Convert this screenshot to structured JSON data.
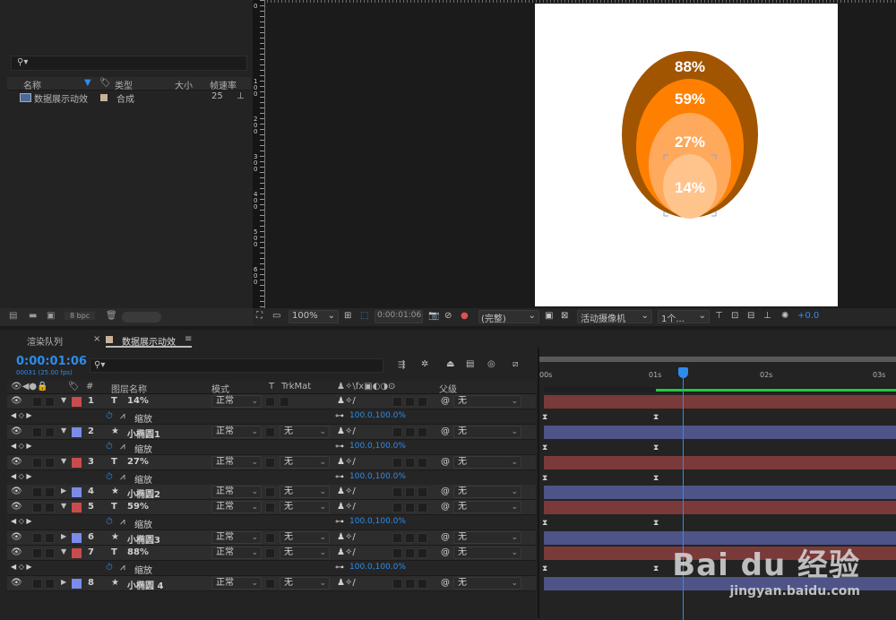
{
  "project": {
    "search_placeholder": "",
    "columns": [
      "名称",
      "类型",
      "大小",
      "帧速率"
    ],
    "items": [
      {
        "name": "数据展示动效",
        "type": "合成",
        "size": "",
        "fps": "25"
      }
    ],
    "bpc": "8 bpc"
  },
  "viewer": {
    "ruler_labels": [
      "0",
      "1 0 0",
      "2 0 0",
      "3 0 0",
      "4 0 0",
      "5 0 0",
      "6 0 0"
    ],
    "zoom": "100%",
    "timecode": "0:00:01:06",
    "resolution": "(完整)",
    "camera": "活动摄像机",
    "view": "1个...",
    "exposure": "+0.0",
    "circles": [
      {
        "label": "88%",
        "color": "#a15500"
      },
      {
        "label": "59%",
        "color": "#ff8000"
      },
      {
        "label": "27%",
        "color": "#ffa95c"
      },
      {
        "label": "14%",
        "color": "#ffc38c"
      }
    ]
  },
  "timeline": {
    "tabs": [
      "渲染队列",
      "数据展示动效"
    ],
    "timecode": "0:00:01:06",
    "fps_info": "00031 (25.00 fps)",
    "columns": {
      "hash": "#",
      "name": "图层名称",
      "mode": "模式",
      "t": "T",
      "trkmat": "TrkMat",
      "parent": "父级"
    },
    "ruler": [
      "00s",
      "01s",
      "02s",
      "03s"
    ],
    "rows": [
      {
        "kind": "layer",
        "num": "1",
        "name": "14%",
        "icon": "T",
        "label_color": "#c94c4c",
        "expanded": true,
        "mode": "正常",
        "trkmat": "",
        "parent": "无"
      },
      {
        "kind": "prop",
        "name": "缩放",
        "value": "100.0,100.0%"
      },
      {
        "kind": "layer",
        "num": "2",
        "name": "小椭圆1",
        "icon": "★",
        "label_color": "#7a8ce8",
        "expanded": true,
        "mode": "正常",
        "trkmat": "无",
        "parent": "无"
      },
      {
        "kind": "prop",
        "name": "缩放",
        "value": "100.0,100.0%"
      },
      {
        "kind": "layer",
        "num": "3",
        "name": "27%",
        "icon": "T",
        "label_color": "#c94c4c",
        "expanded": true,
        "mode": "正常",
        "trkmat": "无",
        "parent": "无"
      },
      {
        "kind": "prop",
        "name": "缩放",
        "value": "100.0,100.0%"
      },
      {
        "kind": "layer",
        "num": "4",
        "name": "小椭圆2",
        "icon": "★",
        "label_color": "#7a8ce8",
        "expanded": false,
        "mode": "正常",
        "trkmat": "无",
        "parent": "无"
      },
      {
        "kind": "layer",
        "num": "5",
        "name": "59%",
        "icon": "T",
        "label_color": "#c94c4c",
        "expanded": true,
        "mode": "正常",
        "trkmat": "无",
        "parent": "无"
      },
      {
        "kind": "prop",
        "name": "缩放",
        "value": "100.0,100.0%"
      },
      {
        "kind": "layer",
        "num": "6",
        "name": "小椭圆3",
        "icon": "★",
        "label_color": "#7a8ce8",
        "expanded": false,
        "mode": "正常",
        "trkmat": "无",
        "parent": "无"
      },
      {
        "kind": "layer",
        "num": "7",
        "name": "88%",
        "icon": "T",
        "label_color": "#c94c4c",
        "expanded": true,
        "mode": "正常",
        "trkmat": "无",
        "parent": "无"
      },
      {
        "kind": "prop",
        "name": "缩放",
        "value": "100.0,100.0%"
      },
      {
        "kind": "layer",
        "num": "8",
        "name": "小椭圆 4",
        "icon": "★",
        "label_color": "#7a8ce8",
        "expanded": false,
        "mode": "正常",
        "trkmat": "无",
        "parent": "无"
      }
    ]
  },
  "watermark": {
    "brand": "Bai du 经验",
    "url": "jingyan.baidu.com"
  }
}
